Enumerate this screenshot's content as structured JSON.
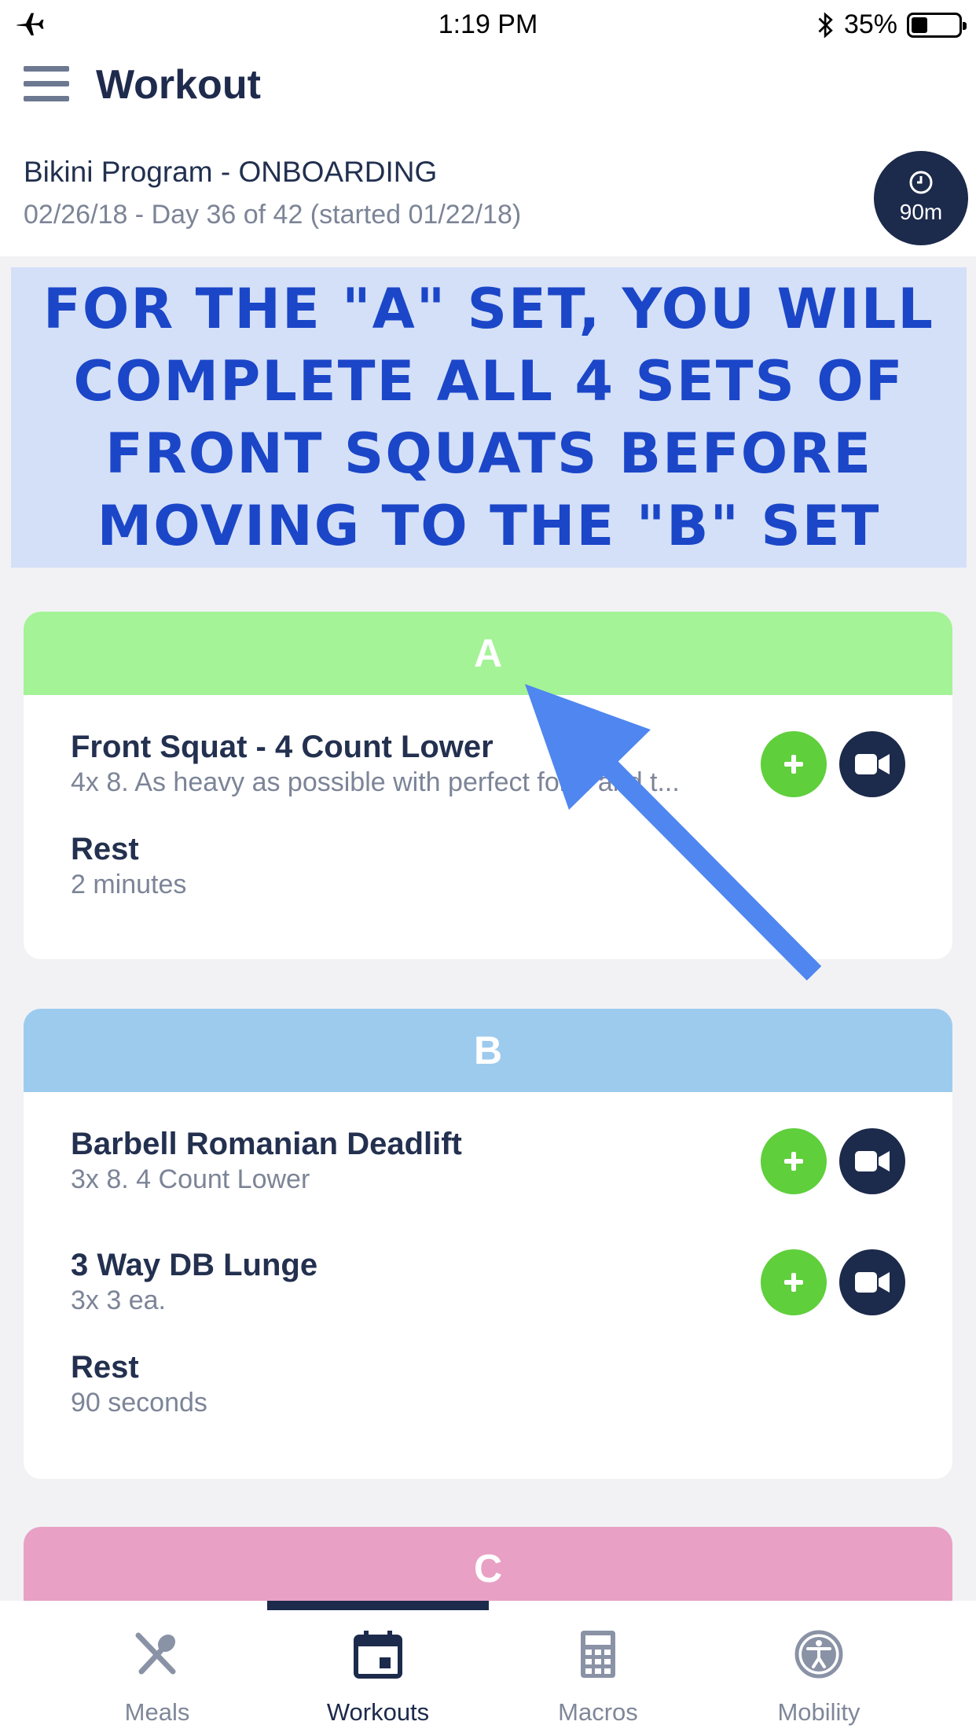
{
  "status_bar": {
    "time": "1:19 PM",
    "battery": "35%",
    "battery_level": 0.35
  },
  "header": {
    "title": "Workout",
    "program_name": "Bikini Program - ONBOARDING",
    "program_meta": "02/26/18 - Day 36 of 42 (started 01/22/18)",
    "timer_label": "90m"
  },
  "banner": {
    "text": "FOR THE \"A\" SET, YOU WILL COMPLETE ALL 4 SETS OF FRONT SQUATS BEFORE MOVING TO THE \"B\" SET"
  },
  "sets": [
    {
      "label": "A",
      "color": "#a4f397",
      "exercises": [
        {
          "name": "Front Squat - 4 Count Lower",
          "desc": "4x 8. As heavy as possible with perfect form and t..."
        }
      ],
      "rest": {
        "title": "Rest",
        "value": "2 minutes"
      }
    },
    {
      "label": "B",
      "color": "#9dcbee",
      "exercises": [
        {
          "name": "Barbell Romanian Deadlift",
          "desc": "3x 8. 4 Count Lower"
        },
        {
          "name": "3 Way DB Lunge",
          "desc": "3x 3 ea."
        }
      ],
      "rest": {
        "title": "Rest",
        "value": "90 seconds"
      }
    },
    {
      "label": "C",
      "color": "#e8a1c4"
    }
  ],
  "tabs": [
    {
      "label": "Meals",
      "icon": "meals-icon"
    },
    {
      "label": "Workouts",
      "icon": "calendar-icon"
    },
    {
      "label": "Macros",
      "icon": "calculator-icon"
    },
    {
      "label": "Mobility",
      "icon": "accessibility-icon"
    }
  ],
  "colors": {
    "primary": "#1c2a4b",
    "add_green": "#5fcf3c",
    "banner_text": "#1b46c8",
    "arrow": "#4f86f0"
  }
}
